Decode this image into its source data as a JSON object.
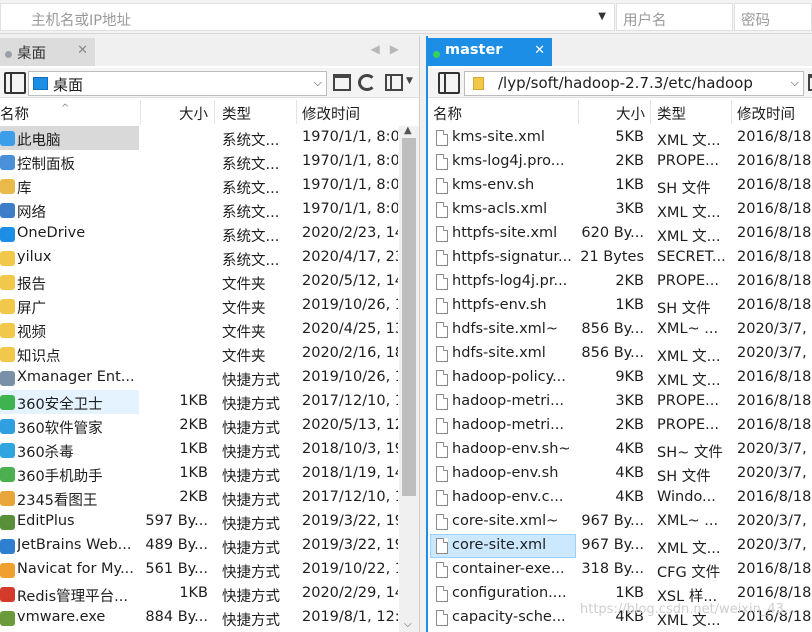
{
  "top": {
    "host_placeholder": "主机名或IP地址",
    "user_placeholder": "用户名",
    "pass_placeholder": "密码"
  },
  "left": {
    "tab": "桌面",
    "path": "桌面",
    "columns": {
      "name": "名称",
      "size": "大小",
      "type": "类型",
      "time": "修改时间"
    },
    "rows": [
      {
        "name": "此电脑",
        "size": "",
        "type": "系统文...",
        "time": "1970/1/1, 8:0",
        "icon": "computer-icon",
        "color": "#3c9ee8"
      },
      {
        "name": "控制面板",
        "size": "",
        "type": "系统文...",
        "time": "1970/1/1, 8:0",
        "icon": "control-panel-icon",
        "color": "#4a90d9"
      },
      {
        "name": "库",
        "size": "",
        "type": "系统文...",
        "time": "1970/1/1, 8:0",
        "icon": "library-icon",
        "color": "#e9b94a"
      },
      {
        "name": "网络",
        "size": "",
        "type": "系统文...",
        "time": "1970/1/1, 8:0",
        "icon": "network-icon",
        "color": "#3c7fc8"
      },
      {
        "name": "OneDrive",
        "size": "",
        "type": "系统文...",
        "time": "2020/2/23, 14",
        "icon": "onedrive-icon",
        "color": "#1c8ee6"
      },
      {
        "name": "yilux",
        "size": "",
        "type": "系统文...",
        "time": "2020/4/17, 23",
        "icon": "user-folder-icon",
        "color": "#f2c84b"
      },
      {
        "name": "报告",
        "size": "",
        "type": "文件夹",
        "time": "2020/5/12, 14",
        "icon": "folder-icon",
        "color": "#f2c84b"
      },
      {
        "name": "屏广",
        "size": "",
        "type": "文件夹",
        "time": "2019/10/26, 1",
        "icon": "folder-icon",
        "color": "#f2c84b"
      },
      {
        "name": "视频",
        "size": "",
        "type": "文件夹",
        "time": "2020/4/25, 13",
        "icon": "folder-icon",
        "color": "#f2c84b"
      },
      {
        "name": "知识点",
        "size": "",
        "type": "文件夹",
        "time": "2020/2/16, 18",
        "icon": "folder-icon",
        "color": "#f2c84b"
      },
      {
        "name": "Xmanager Ent...",
        "size": "",
        "type": "快捷方式",
        "time": "2019/10/26, 1",
        "icon": "shortcut-icon",
        "color": "#7a8fa8"
      },
      {
        "name": "360安全卫士",
        "size": "1KB",
        "type": "快捷方式",
        "time": "2017/12/10, 1",
        "icon": "360-security-icon",
        "color": "#3fb34f"
      },
      {
        "name": "360软件管家",
        "size": "2KB",
        "type": "快捷方式",
        "time": "2020/5/13, 12",
        "icon": "360-software-icon",
        "color": "#2f9fe0"
      },
      {
        "name": "360杀毒",
        "size": "1KB",
        "type": "快捷方式",
        "time": "2018/10/3, 19",
        "icon": "360-antivirus-icon",
        "color": "#2fa5e0"
      },
      {
        "name": "360手机助手",
        "size": "1KB",
        "type": "快捷方式",
        "time": "2018/1/19, 14",
        "icon": "360-phone-icon",
        "color": "#4cb050"
      },
      {
        "name": "2345看图王",
        "size": "2KB",
        "type": "快捷方式",
        "time": "2017/12/10, 1",
        "icon": "2345-viewer-icon",
        "color": "#e8a53a"
      },
      {
        "name": "EditPlus",
        "size": "597 By...",
        "type": "快捷方式",
        "time": "2019/3/22, 19",
        "icon": "editplus-icon",
        "color": "#5a8f3a"
      },
      {
        "name": "JetBrains Web...",
        "size": "489 By...",
        "type": "快捷方式",
        "time": "2019/3/22, 19",
        "icon": "jetbrains-icon",
        "color": "#2f7fd0"
      },
      {
        "name": "Navicat for My...",
        "size": "561 By...",
        "type": "快捷方式",
        "time": "2019/10/22, 1",
        "icon": "navicat-icon",
        "color": "#f0a030"
      },
      {
        "name": "Redis管理平台...",
        "size": "1KB",
        "type": "快捷方式",
        "time": "2020/2/29, 14",
        "icon": "redis-icon",
        "color": "#d33a2c"
      },
      {
        "name": "vmware.exe",
        "size": "884 By...",
        "type": "快捷方式",
        "time": "2019/8/1, 12:",
        "icon": "vmware-icon",
        "color": "#6a9a3a"
      }
    ]
  },
  "right": {
    "tab": "master",
    "path": "/lyp/soft/hadoop-2.7.3/etc/hadoop",
    "columns": {
      "name": "名称",
      "size": "大小",
      "type": "类型",
      "time": "修改时间"
    },
    "rows": [
      {
        "name": "kms-site.xml",
        "size": "5KB",
        "type": "XML 文...",
        "time": "2016/8/18"
      },
      {
        "name": "kms-log4j.pro...",
        "size": "2KB",
        "type": "PROPE...",
        "time": "2016/8/18"
      },
      {
        "name": "kms-env.sh",
        "size": "1KB",
        "type": "SH 文件",
        "time": "2016/8/18"
      },
      {
        "name": "kms-acls.xml",
        "size": "3KB",
        "type": "XML 文...",
        "time": "2016/8/18"
      },
      {
        "name": "httpfs-site.xml",
        "size": "620 By...",
        "type": "XML 文...",
        "time": "2016/8/18"
      },
      {
        "name": "httpfs-signatur...",
        "size": "21 Bytes",
        "type": "SECRET...",
        "time": "2016/8/18"
      },
      {
        "name": "httpfs-log4j.pr...",
        "size": "2KB",
        "type": "PROPE...",
        "time": "2016/8/18"
      },
      {
        "name": "httpfs-env.sh",
        "size": "1KB",
        "type": "SH 文件",
        "time": "2016/8/18"
      },
      {
        "name": "hdfs-site.xml~",
        "size": "856 By...",
        "type": "XML~ ...",
        "time": "2020/3/7,"
      },
      {
        "name": "hdfs-site.xml",
        "size": "856 By...",
        "type": "XML 文...",
        "time": "2020/3/7,"
      },
      {
        "name": "hadoop-policy...",
        "size": "9KB",
        "type": "XML 文...",
        "time": "2016/8/18"
      },
      {
        "name": "hadoop-metri...",
        "size": "3KB",
        "type": "PROPE...",
        "time": "2016/8/18"
      },
      {
        "name": "hadoop-metri...",
        "size": "2KB",
        "type": "PROPE...",
        "time": "2016/8/18"
      },
      {
        "name": "hadoop-env.sh~",
        "size": "4KB",
        "type": "SH~ 文件",
        "time": "2020/3/7,"
      },
      {
        "name": "hadoop-env.sh",
        "size": "4KB",
        "type": "SH 文件",
        "time": "2020/3/7,"
      },
      {
        "name": "hadoop-env.c...",
        "size": "4KB",
        "type": "Windo...",
        "time": "2016/8/18"
      },
      {
        "name": "core-site.xml~",
        "size": "967 By...",
        "type": "XML~ ...",
        "time": "2020/3/7,"
      },
      {
        "name": "core-site.xml",
        "size": "967 By...",
        "type": "XML 文...",
        "time": "2020/3/7,"
      },
      {
        "name": "container-exe...",
        "size": "318 By...",
        "type": "CFG 文件",
        "time": "2016/8/18"
      },
      {
        "name": "configuration....",
        "size": "1KB",
        "type": "XSL 样...",
        "time": "2016/8/18"
      },
      {
        "name": "capacity-sche...",
        "size": "4KB",
        "type": "XML 文...",
        "time": "2016/8/18"
      }
    ]
  },
  "colors": {
    "accent": "#1c8ee6",
    "selection": "#cce8ff",
    "selection_gray": "#d9d9d9"
  },
  "watermark": "https://blog.csdn.net/weixin_43..."
}
